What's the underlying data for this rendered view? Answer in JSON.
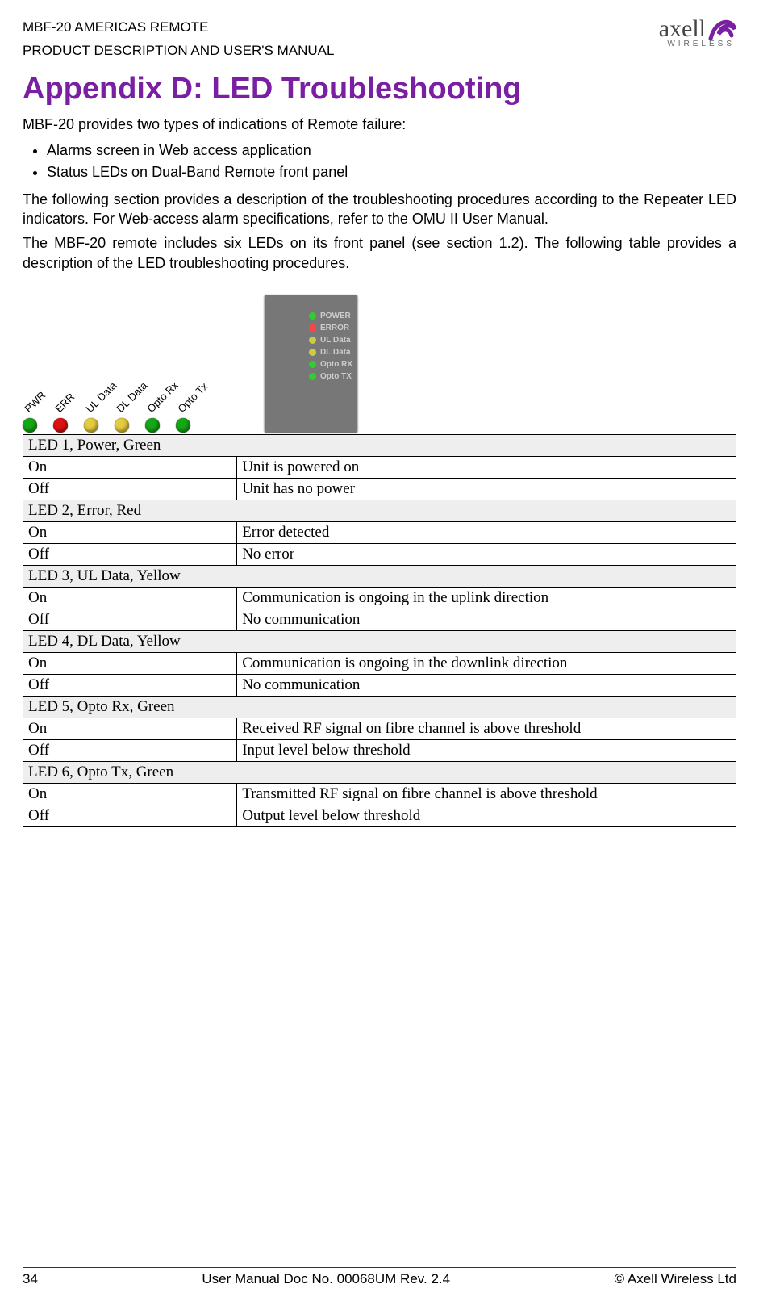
{
  "header": {
    "line1": "MBF-20 AMERICAS REMOTE",
    "line2": "PRODUCT DESCRIPTION AND USER'S MANUAL",
    "logo_top": "axell",
    "logo_bottom": "WIRELESS"
  },
  "title": "Appendix D: LED Troubleshooting",
  "intro": "MBF-20 provides two types of indications of Remote failure:",
  "bullets": [
    "Alarms screen in Web access application",
    "Status LEDs on Dual-Band Remote front panel"
  ],
  "para1": "The following section provides a description of the troubleshooting procedures according to the Repeater LED indicators. For Web-access alarm specifications, refer to the OMU II User Manual.",
  "para2": "The MBF-20 remote includes six LEDs on its front panel (see section 1.2). The following table provides a description of the LED troubleshooting procedures.",
  "leds": [
    {
      "label": "PWR",
      "color": "#15a815"
    },
    {
      "label": "ERR",
      "color": "#d11"
    },
    {
      "label": "UL Data",
      "color": "#e4cc3c"
    },
    {
      "label": "DL Data",
      "color": "#e4cc3c"
    },
    {
      "label": "Opto Rx",
      "color": "#15a815"
    },
    {
      "label": "Opto Tx",
      "color": "#15a815"
    }
  ],
  "photo_labels": [
    "POWER",
    "ERROR",
    "UL Data",
    "DL Data",
    "Opto RX",
    "Opto TX"
  ],
  "table": [
    {
      "type": "section",
      "text": "LED 1, Power, Green"
    },
    {
      "type": "row",
      "c1": "On",
      "c2": "Unit is powered on"
    },
    {
      "type": "row",
      "c1": "Off",
      "c2": "Unit has no power"
    },
    {
      "type": "section",
      "text": "LED 2, Error, Red"
    },
    {
      "type": "row",
      "c1": "On",
      "c2": "Error detected"
    },
    {
      "type": "row",
      "c1": "Off",
      "c2": "No error"
    },
    {
      "type": "section",
      "text": "LED 3, UL Data, Yellow"
    },
    {
      "type": "row",
      "c1": "On",
      "c2": "Communication is ongoing in the uplink direction"
    },
    {
      "type": "row",
      "c1": "Off",
      "c2": "No communication"
    },
    {
      "type": "section",
      "text": "LED 4, DL Data, Yellow"
    },
    {
      "type": "row",
      "c1": "On",
      "c2": "Communication is ongoing in the downlink direction"
    },
    {
      "type": "row",
      "c1": "Off",
      "c2": "No communication"
    },
    {
      "type": "section",
      "text": "LED 5, Opto Rx, Green"
    },
    {
      "type": "row",
      "c1": "On",
      "c2": "Received RF signal on fibre channel is above threshold"
    },
    {
      "type": "row",
      "c1": "Off",
      "c2": "Input level below threshold"
    },
    {
      "type": "section",
      "text": "LED 6, Opto Tx, Green"
    },
    {
      "type": "row",
      "c1": "On",
      "c2": "Transmitted RF signal on fibre channel is above threshold"
    },
    {
      "type": "row",
      "c1": "Off",
      "c2": "Output level below threshold"
    }
  ],
  "footer": {
    "page": "34",
    "center": "User Manual Doc No. 00068UM Rev. 2.4",
    "right": "© Axell Wireless Ltd"
  }
}
